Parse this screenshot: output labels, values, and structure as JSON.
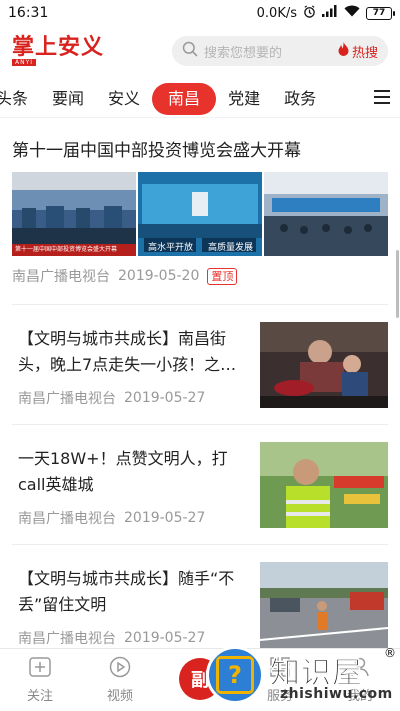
{
  "status_bar": {
    "time": "16:31",
    "net_speed": "0.0K/s",
    "battery": "77"
  },
  "header": {
    "logo_text": "掌上安义",
    "logo_sub": "ANYI",
    "search_placeholder": "搜索您想要的",
    "hot_label": "热搜"
  },
  "tabs": [
    {
      "label": "头条",
      "active": false
    },
    {
      "label": "要闻",
      "active": false
    },
    {
      "label": "安义",
      "active": false
    },
    {
      "label": "南昌",
      "active": true
    },
    {
      "label": "党建",
      "active": false
    },
    {
      "label": "政务",
      "active": false
    }
  ],
  "feed": {
    "featured": {
      "title": "第十一届中国中部投资博览会盛大开幕",
      "images": [
        {
          "caption": "第十一届中国中部投资博览会盛大开幕"
        },
        {
          "caption_a": "高水平开放",
          "caption_b": "高质量发展"
        },
        {
          "caption": ""
        }
      ],
      "source": "南昌广播电视台",
      "date": "2019-05-20",
      "badge": "置顶"
    },
    "articles": [
      {
        "title": "【文明与城市共成长】南昌街头，晚上7点走失一小孩！之…",
        "source": "南昌广播电视台",
        "date": "2019-05-27"
      },
      {
        "title": "一天18W+！点赞文明人，打call英雄城",
        "source": "南昌广播电视台",
        "date": "2019-05-27"
      },
      {
        "title": "【文明与城市共成长】随手“不丢”留住文明",
        "source": "南昌广播电视台",
        "date": "2019-05-27"
      }
    ]
  },
  "bottom_nav": {
    "items": [
      {
        "label": "关注",
        "icon": "plus-box-icon"
      },
      {
        "label": "视频",
        "icon": "play-circle-icon"
      },
      {
        "label": "副",
        "icon": "center-logo"
      },
      {
        "label": "服务",
        "icon": "grid-icon"
      },
      {
        "label": "我的",
        "icon": "user-icon"
      }
    ]
  },
  "watermark": {
    "text": "知识屋",
    "sub": "zhishiwu.com",
    "reg": "®"
  },
  "colors": {
    "brand_red": "#d8231e",
    "active_tab": "#e8322c",
    "meta_gray": "#999999"
  }
}
